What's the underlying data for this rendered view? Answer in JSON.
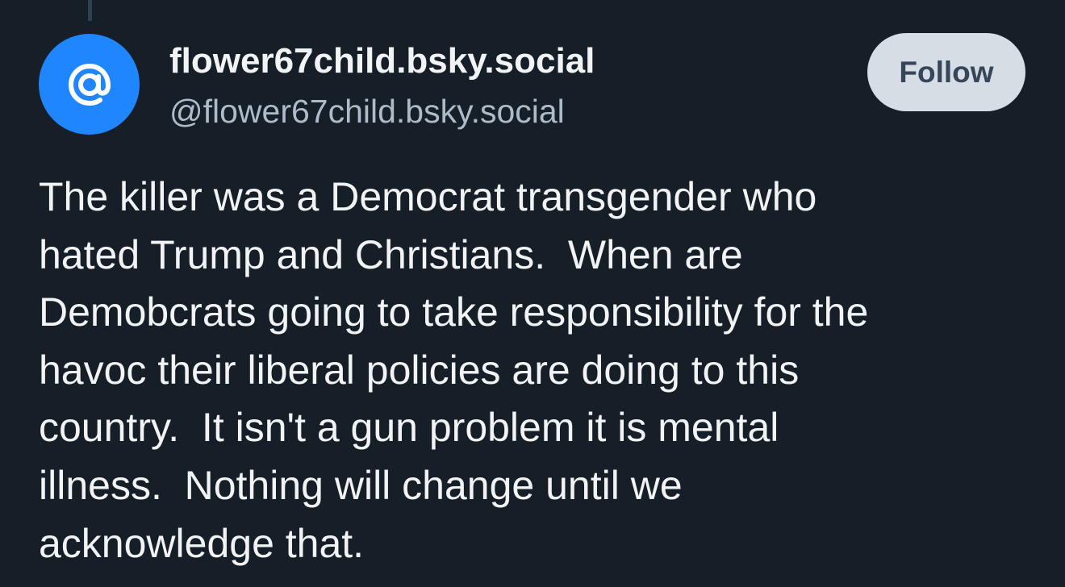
{
  "post": {
    "author": {
      "display_name": "flower67child.bsky.social",
      "handle": "@flower67child.bsky.social",
      "avatar_icon": "at-sign-icon",
      "avatar_color": "#1f86ff"
    },
    "follow_label": "Follow",
    "text_lines": [
      "The killer was a Democrat transgender who",
      "hated Trump and Christians.  When are",
      "Demobcrats going to take responsibility for the",
      "havoc their liberal policies are doing to this",
      "country.  It isn't a gun problem it is mental",
      "illness.  Nothing will change until we",
      "acknowledge that."
    ]
  },
  "colors": {
    "background": "#161e27",
    "text_primary": "#f1f3f5",
    "text_secondary": "#aebbc9",
    "button_bg": "#d7dde5",
    "button_text": "#35465a",
    "thread_line": "#2e4052"
  }
}
